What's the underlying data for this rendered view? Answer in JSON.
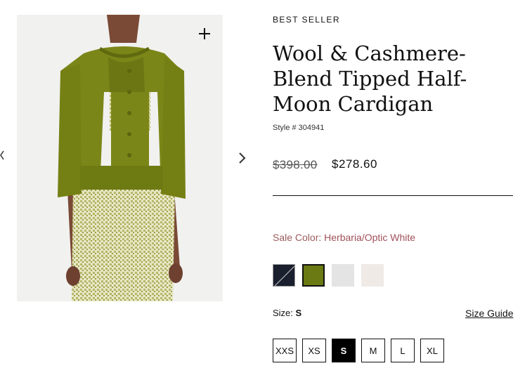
{
  "product": {
    "badge": "BEST SELLER",
    "title": "Wool & Cashmere-Blend Tipped Half-Moon Cardigan",
    "style_number": "Style # 304941",
    "original_price": "$398.00",
    "sale_price": "$278.60"
  },
  "gallery": {
    "zoom_icon": "plus-icon",
    "prev_icon": "chevron-left-icon",
    "next_icon": "chevron-right-icon"
  },
  "color": {
    "label": "Sale Color:",
    "selected": "Herbaria/Optic White",
    "swatches": [
      {
        "name": "navy",
        "color": "#1a1f2e"
      },
      {
        "name": "herbaria",
        "color": "#6b7a12"
      },
      {
        "name": "light-grey",
        "color": "#e4e4e4"
      },
      {
        "name": "off-white",
        "color": "#efeae6"
      }
    ]
  },
  "size": {
    "label": "Size:",
    "selected": "S",
    "guide_label": "Size Guide",
    "options": [
      "XXS",
      "XS",
      "S",
      "M",
      "L",
      "XL"
    ]
  },
  "colors": {
    "sale_label": "#9c5b5b",
    "accent": "#000000"
  }
}
